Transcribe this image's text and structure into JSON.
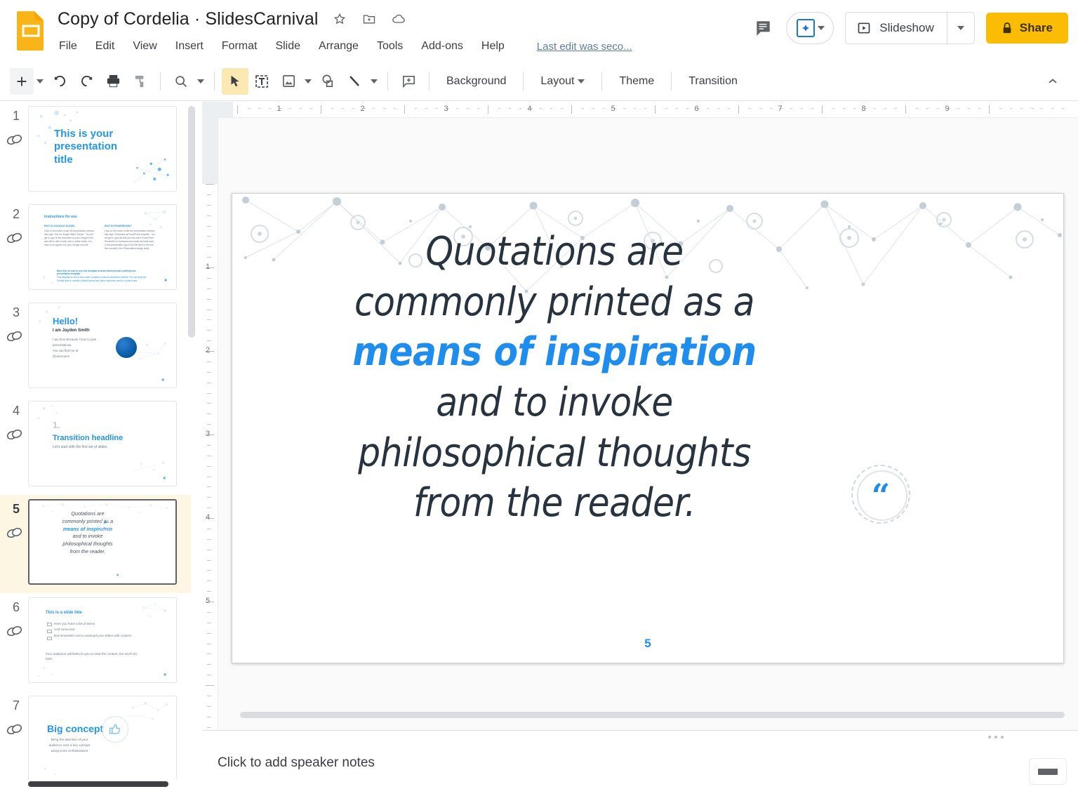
{
  "header": {
    "doc_title": "Copy of Cordelia · SlidesCarnival",
    "icons": {
      "app_logo": "google-slides-logo",
      "star": "star-icon",
      "move_to_folder": "move-to-folder-icon",
      "cloud_saved": "cloud-saved-icon",
      "comment_history": "comment-history-icon"
    },
    "menus": [
      "File",
      "Edit",
      "View",
      "Insert",
      "Format",
      "Slide",
      "Arrange",
      "Tools",
      "Add-ons",
      "Help"
    ],
    "last_edit": "Last edit was seco...",
    "present_chip_label": "",
    "slideshow_label": "Slideshow",
    "share_label": "Share"
  },
  "toolbar": {
    "items": [
      {
        "name": "new-slide-button",
        "icon": "plus-icon"
      },
      {
        "name": "new-slide-dropdown",
        "icon": "caret-down-icon"
      },
      {
        "name": "undo-button",
        "icon": "undo-icon"
      },
      {
        "name": "redo-button",
        "icon": "redo-icon"
      },
      {
        "name": "print-button",
        "icon": "printer-icon"
      },
      {
        "name": "paint-format-button",
        "icon": "paint-format-icon"
      },
      {
        "name": "zoom-button",
        "icon": "zoom-icon"
      },
      {
        "name": "zoom-dropdown",
        "icon": "caret-down-icon"
      },
      {
        "name": "select-tool-button",
        "icon": "cursor-arrow-icon"
      },
      {
        "name": "text-box-button",
        "icon": "text-box-icon"
      },
      {
        "name": "insert-image-button",
        "icon": "image-icon"
      },
      {
        "name": "insert-image-dropdown",
        "icon": "caret-down-icon"
      },
      {
        "name": "shape-button",
        "icon": "shape-icon"
      },
      {
        "name": "line-button",
        "icon": "line-icon"
      },
      {
        "name": "line-dropdown",
        "icon": "caret-down-icon"
      },
      {
        "name": "insert-comment-button",
        "icon": "add-comment-icon"
      }
    ],
    "background_label": "Background",
    "layout_label": "Layout",
    "theme_label": "Theme",
    "transition_label": "Transition",
    "collapse_icon": "chevron-up-icon"
  },
  "filmstrip": {
    "slides": [
      {
        "number": "1",
        "type": "title",
        "title": "This is your presentation title"
      },
      {
        "number": "2",
        "type": "two-col",
        "title": "Instructions for use",
        "col1_head": "EDIT IN GOOGLE SLIDES",
        "col1_body": "Click on the button under the presentation preview that says \"Use as Google Slides Theme\". You will get a copy of this document on your Google Drive and will be able to edit, add or delete slides. You have to be signed in to your Google account.",
        "col2_head": "EDIT IN POWERPOINT",
        "col2_body": "Click on the button under the presentation preview that says \"Download as PowerPoint template\". You will get a .pptx file that you can edit in PowerPoint. Remember to download and install the fonts used in this presentation (you'll find the links to the font files needed in the Presentation design slide)",
        "foot1": "More info on how to use this template at www.slidescarnival.com/help-use-presentation-template",
        "foot2": "This template is free to use under Creative Commons Attribution license. You can keep the Credits slide or mention SlidesCarnival and other resources used in a slide footer."
      },
      {
        "number": "3",
        "type": "hello",
        "title": "Hello!",
        "subtitle": "I am Jayden Smith",
        "body": "I am here because I love to give presentations.\nYou can find me at\n@username"
      },
      {
        "number": "4",
        "type": "transition",
        "big": "1.",
        "title": "Transition headline",
        "body": "Let's start with the first set of slides."
      },
      {
        "number": "5",
        "type": "quote",
        "selected": true,
        "lines": [
          "Quotations are",
          "commonly printed as a",
          "means of inspiration",
          "and to invoke",
          "philosophical thoughts",
          "from the reader."
        ]
      },
      {
        "number": "6",
        "type": "bullets",
        "title": "This is a slide title",
        "bullets": [
          "Here you have a list of items",
          "And some text",
          "But remember not to overload your slides with content"
        ],
        "body": "Your audience will listen to you or read the content, but won't do both."
      },
      {
        "number": "7",
        "type": "bigconcept",
        "title": "Big concept",
        "body": "Bring the attention of your audience over a key concept using icons or illustrations"
      }
    ],
    "scrollbar": "filmstrip-scrollbar"
  },
  "editor": {
    "ruler_h_numbers": [
      "1",
      "2",
      "3",
      "4",
      "5",
      "6",
      "7",
      "8",
      "9"
    ],
    "ruler_v_numbers": [
      "1",
      "2",
      "3",
      "4",
      "5"
    ],
    "slide": {
      "line1": "Quotations are",
      "line2": "commonly printed as a",
      "highlight": "means of inspiration",
      "line3": "and to invoke",
      "line4": "philosophical thoughts",
      "line5": "from the reader.",
      "quote_glyph": "“",
      "page_number": "5",
      "accent_color": "#1f8ded",
      "text_color": "#283340"
    }
  },
  "notes": {
    "placeholder": "Click to add speaker notes",
    "expand_icon": "minimize-icon"
  }
}
